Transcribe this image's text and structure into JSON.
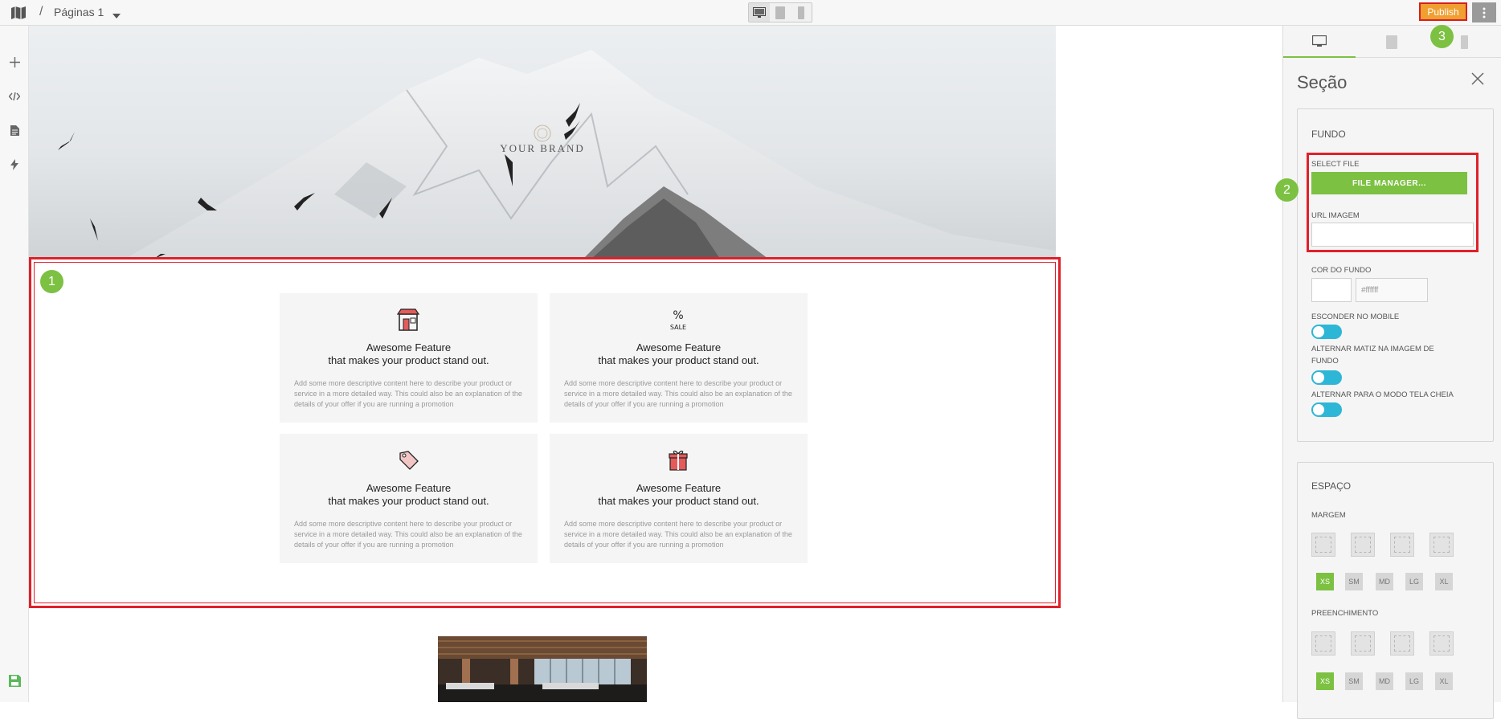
{
  "topbar": {
    "separator": "/",
    "page_name": "Páginas 1",
    "publish_label": "Publish"
  },
  "hero": {
    "brand": "YOUR BRAND"
  },
  "badges": {
    "one": "1",
    "two": "2",
    "three": "3"
  },
  "features": [
    {
      "icon": "store-icon",
      "title_line1": "Awesome Feature",
      "title_line2": "that makes your product stand out.",
      "description": "Add some more descriptive content here to describe your product or service in a more detailed way. This could also be an explanation of the details of your offer if you are running a promotion"
    },
    {
      "icon": "sale-icon",
      "title_line1": "Awesome Feature",
      "title_line2": "that makes your product stand out.",
      "description": "Add some more descriptive content here to describe your product or service in a more detailed way. This could also be an explanation of the details of your offer if you are running a promotion"
    },
    {
      "icon": "tag-icon",
      "title_line1": "Awesome Feature",
      "title_line2": "that makes your product stand out.",
      "description": "Add some more descriptive content here to describe your product or service in a more detailed way. This could also be an explanation of the details of your offer if you are running a promotion"
    },
    {
      "icon": "gift-icon",
      "title_line1": "Awesome Feature",
      "title_line2": "that makes your product stand out.",
      "description": "Add some more descriptive content here to describe your product or service in a more detailed way. This could also be an explanation of the details of your offer if you are running a promotion"
    }
  ],
  "panel": {
    "title": "Seção",
    "background": {
      "heading": "FUNDO",
      "select_file_label": "SELECT FILE",
      "file_manager_button": "FILE MANAGER...",
      "url_image_label": "URL IMAGEM",
      "url_image_value": "",
      "color_label": "COR DO FUNDO",
      "color_value": "#ffffff",
      "hide_mobile_label": "ESCONDER NO MOBILE",
      "tint_label": "ALTERNAR MATIZ NA IMAGEM DE FUNDO",
      "fullscreen_label": "ALTERNAR PARA O MODO TELA CHEIA"
    },
    "spacing": {
      "heading": "ESPAÇO",
      "margin_label": "MARGEM",
      "padding_label": "PREENCHIMENTO",
      "breakpoints": [
        "XS",
        "SM",
        "MD",
        "LG",
        "XL"
      ],
      "active_breakpoint": "XS"
    }
  },
  "colors": {
    "accent_green": "#7cc142",
    "toggle_blue": "#2eb6d6",
    "publish_orange": "#f0a030",
    "highlight_red": "#e0202a"
  }
}
